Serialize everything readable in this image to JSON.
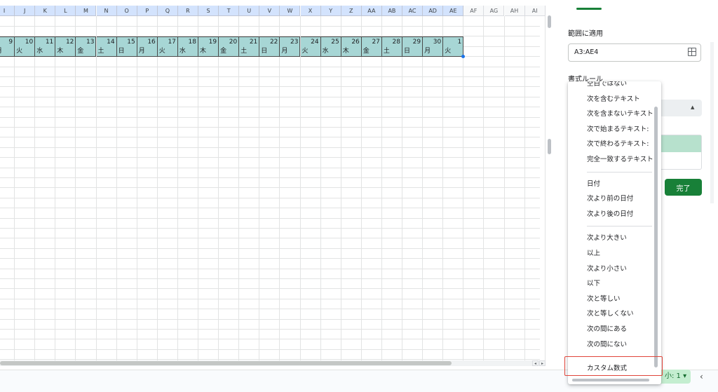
{
  "grid": {
    "columns": [
      "I",
      "J",
      "K",
      "L",
      "M",
      "N",
      "O",
      "P",
      "Q",
      "R",
      "S",
      "T",
      "U",
      "V",
      "W",
      "X",
      "Y",
      "Z",
      "AA",
      "AB",
      "AC",
      "AD",
      "AE",
      "AF",
      "AG",
      "AH",
      "AI"
    ],
    "selected_columns": 23,
    "day_numbers": [
      "9",
      "10",
      "11",
      "12",
      "13",
      "14",
      "15",
      "16",
      "17",
      "18",
      "19",
      "20",
      "21",
      "22",
      "23",
      "24",
      "25",
      "26",
      "27",
      "28",
      "29",
      "30",
      "1"
    ],
    "weekdays": [
      "月",
      "火",
      "水",
      "木",
      "金",
      "土",
      "日",
      "月",
      "火",
      "水",
      "木",
      "金",
      "土",
      "日",
      "月",
      "火",
      "水",
      "木",
      "金",
      "土",
      "日",
      "月",
      "火"
    ],
    "colors": {
      "selected_header": "#d3e3fd",
      "cell_fill": "#a7d6d5",
      "selection_handle": "#1a73e8"
    }
  },
  "panel": {
    "range_title": "範囲に適用",
    "range_value": "A3:AE4",
    "rule_title": "書式ルール",
    "done_label": "完了",
    "accent": "#188038"
  },
  "menu": {
    "groups": [
      [
        "空白ではない",
        "次を含むテキスト",
        "次を含まないテキスト",
        "次で始まるテキスト:",
        "次で終わるテキスト:",
        "完全一致するテキスト"
      ],
      [
        "日付",
        "次より前の日付",
        "次より後の日付"
      ],
      [
        "次より大きい",
        "以上",
        "次より小さい",
        "以下",
        "次と等しい",
        "次と等しくない",
        "次の間にある",
        "次の間にない"
      ],
      [
        "カスタム数式"
      ]
    ],
    "highlighted": "カスタム数式",
    "highlight_color": "#e0453a"
  },
  "bottom": {
    "sum_label": "小: 1"
  }
}
